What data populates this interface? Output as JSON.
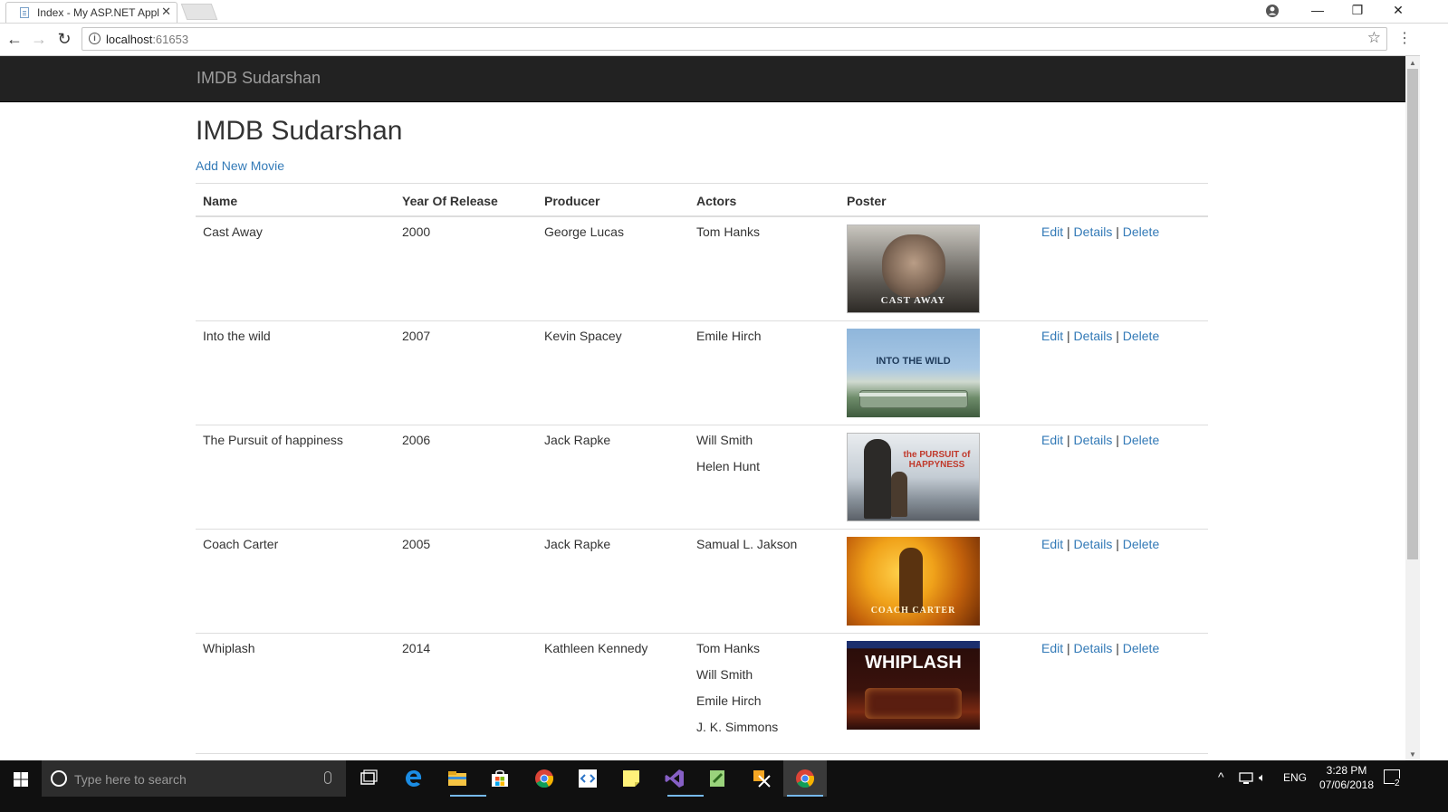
{
  "browser": {
    "tab_title": "Index - My ASP.NET Appl",
    "url_host": "localhost",
    "url_port": ":61653"
  },
  "page": {
    "brand": "IMDB Sudarshan",
    "title": "IMDB Sudarshan",
    "add_link": "Add New Movie",
    "columns": [
      "Name",
      "Year Of Release",
      "Producer",
      "Actors",
      "Poster"
    ],
    "action_labels": {
      "edit": "Edit",
      "details": "Details",
      "delete": "Delete",
      "separator": "|"
    },
    "movies": [
      {
        "name": "Cast Away",
        "year": "2000",
        "producer": "George Lucas",
        "actors": [
          "Tom Hanks"
        ],
        "poster_text": "CAST AWAY"
      },
      {
        "name": "Into the wild",
        "year": "2007",
        "producer": "Kevin Spacey",
        "actors": [
          "Emile Hirch"
        ],
        "poster_text": "INTO THE WILD"
      },
      {
        "name": "The Pursuit of happiness",
        "year": "2006",
        "producer": "Jack Rapke",
        "actors": [
          "Will Smith",
          "Helen Hunt"
        ],
        "poster_text": "the PURSUIT of HAPPYNESS"
      },
      {
        "name": "Coach Carter",
        "year": "2005",
        "producer": "Jack Rapke",
        "actors": [
          "Samual L. Jakson"
        ],
        "poster_text": "COACH CARTER"
      },
      {
        "name": "Whiplash",
        "year": "2014",
        "producer": "Kathleen Kennedy",
        "actors": [
          "Tom Hanks",
          "Will Smith",
          "Emile Hirch",
          "J. K. Simmons"
        ],
        "poster_text": "WHIPLASH"
      }
    ]
  },
  "taskbar": {
    "search_placeholder": "Type here to search",
    "language": "ENG",
    "time": "3:28 PM",
    "date": "07/06/2018",
    "notification_count": "2"
  },
  "colors": {
    "navbar": "#222222",
    "link": "#337ab7",
    "brand_text": "#9d9d9d",
    "taskbar": "#101010"
  }
}
